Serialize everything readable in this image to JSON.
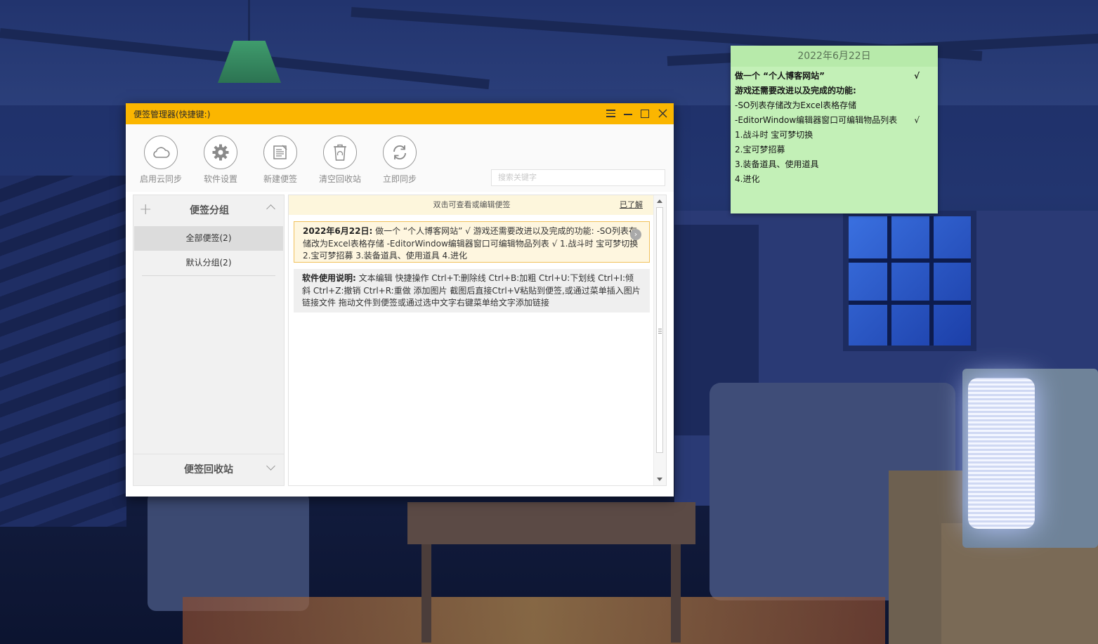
{
  "sticky": {
    "date": "2022年6月22日",
    "lines": [
      {
        "text": "做一个 “个人博客网站”",
        "bold": true,
        "check": "√"
      },
      {
        "text": "游戏还需要改进以及完成的功能:",
        "bold": true,
        "check": ""
      },
      {
        "text": "-SO列表存储改为Excel表格存储",
        "bold": false,
        "check": ""
      },
      {
        "text": "-EditorWindow编辑器窗口可编辑物品列表",
        "bold": false,
        "check": "√"
      },
      {
        "text": "1.战斗时 宝可梦切换",
        "bold": false,
        "check": ""
      },
      {
        "text": "2.宝可梦招募",
        "bold": false,
        "check": ""
      },
      {
        "text": "3.装备道具、使用道具",
        "bold": false,
        "check": ""
      },
      {
        "text": "4.进化",
        "bold": false,
        "check": ""
      }
    ],
    "bg_color": "#c3f0b7"
  },
  "window": {
    "title": "便签管理器(快捷键:)",
    "accent_color": "#fbb600",
    "toolbar": [
      {
        "label": "启用云同步",
        "icon": "cloud-icon"
      },
      {
        "label": "软件设置",
        "icon": "gear-icon"
      },
      {
        "label": "新建便签",
        "icon": "new-note-icon"
      },
      {
        "label": "清空回收站",
        "icon": "recycle-bin-icon"
      },
      {
        "label": "立即同步",
        "icon": "sync-icon"
      }
    ],
    "search_placeholder": "搜索关键字",
    "sidebar": {
      "groups_title": "便签分组",
      "items": [
        {
          "label": "全部便签(2)",
          "active": true
        },
        {
          "label": "默认分组(2)",
          "active": false
        }
      ],
      "recycle_title": "便签回收站"
    },
    "hint": {
      "text": "双击可查看或编辑便签",
      "link": "已了解"
    },
    "notes": [
      {
        "title": "2022年6月22日:",
        "body": "做一个 “个人博客网站”                  √ 游戏还需要改进以及完成的功能:   -SO列表存储改为Excel表格存储 -EditorWindow编辑器窗口可编辑物品列表      √ 1.战斗时 宝可梦切换 2.宝可梦招募 3.装备道具、使用道具 4.进化"
      },
      {
        "title": "软件使用说明:",
        "body": "文本编辑  快捷操作 Ctrl+T:删除线 Ctrl+B:加粗 Ctrl+U:下划线 Ctrl+I:倾斜 Ctrl+Z:撤销 Ctrl+R:重做  添加图片 截图后直接Ctrl+V粘贴到便签,或通过菜单插入图片  链接文件 拖动文件到便签或通过选中文字右键菜单给文字添加链接"
      }
    ]
  }
}
